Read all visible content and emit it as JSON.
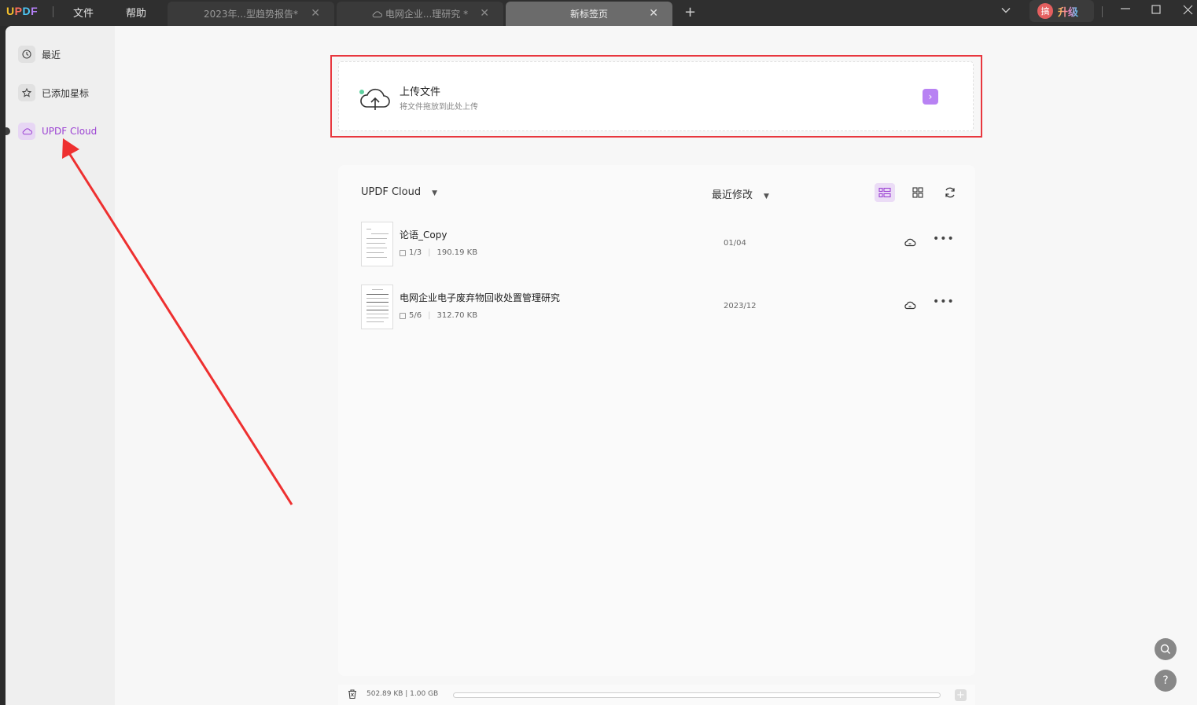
{
  "app": {
    "logo": {
      "u": "U",
      "p": "P",
      "d": "D",
      "f": "F"
    },
    "menus": [
      "文件",
      "帮助"
    ],
    "tabs": [
      {
        "label": "2023年...型趋势报告*",
        "cloud": false
      },
      {
        "label": "电网企业...理研究 *",
        "cloud": true
      },
      {
        "label": "新标签页",
        "cloud": false
      }
    ],
    "new_tab": "+",
    "upgrade": {
      "avatar": "搞",
      "label": "升级"
    }
  },
  "sidebar": {
    "items": [
      {
        "label": "最近",
        "icon": "clock-icon"
      },
      {
        "label": "已添加星标",
        "icon": "star-icon"
      },
      {
        "label": "UPDF Cloud",
        "icon": "cloud-icon"
      }
    ]
  },
  "upload": {
    "title": "上传文件",
    "subtitle": "将文件拖放到此处上传",
    "go": "›"
  },
  "panel": {
    "location": "UPDF Cloud",
    "sort": "最近修改",
    "files": [
      {
        "name": "论语_Copy",
        "pages": "1/3",
        "size": "190.19 KB",
        "date": "01/04"
      },
      {
        "name": "电网企业电子废弃物回收处置管理研究",
        "pages": "5/6",
        "size": "312.70 KB",
        "date": "2023/12"
      }
    ]
  },
  "storage": {
    "text": "502.89 KB | 1.00 GB",
    "used_fraction": 0.0005,
    "plus": "+"
  },
  "help": "?",
  "colors": {
    "accent": "#9c43d3",
    "upload_go": "#b882f3",
    "highlight_box": "#e8373e",
    "arrow": "#ee3030"
  }
}
